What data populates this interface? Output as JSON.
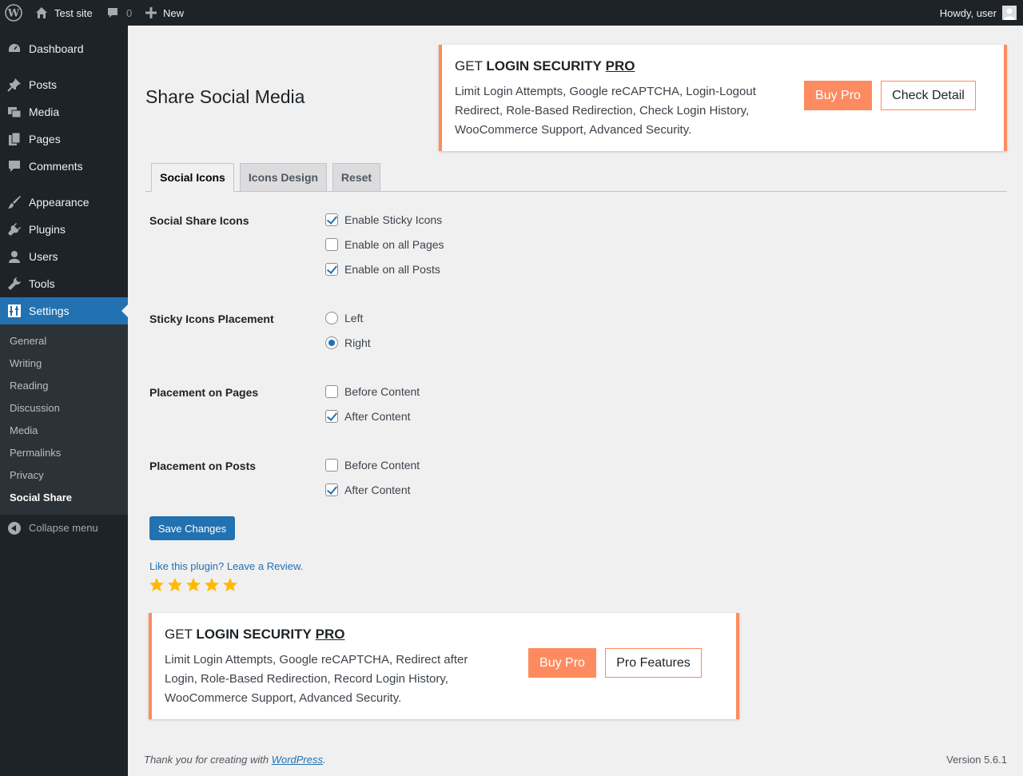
{
  "adminbar": {
    "site_name": "Test site",
    "comments_count": "0",
    "new_label": "New",
    "howdy": "Howdy, user"
  },
  "sidebar": {
    "items": [
      {
        "label": "Dashboard",
        "icon": "dashboard-icon"
      },
      {
        "label": "Posts",
        "icon": "pin-icon"
      },
      {
        "label": "Media",
        "icon": "media-icon"
      },
      {
        "label": "Pages",
        "icon": "pages-icon"
      },
      {
        "label": "Comments",
        "icon": "comment-icon"
      },
      {
        "label": "Appearance",
        "icon": "brush-icon"
      },
      {
        "label": "Plugins",
        "icon": "plugin-icon"
      },
      {
        "label": "Users",
        "icon": "user-icon"
      },
      {
        "label": "Tools",
        "icon": "wrench-icon"
      },
      {
        "label": "Settings",
        "icon": "settings-icon"
      }
    ],
    "submenu": [
      "General",
      "Writing",
      "Reading",
      "Discussion",
      "Media",
      "Permalinks",
      "Privacy",
      "Social Share"
    ],
    "collapse_label": "Collapse menu"
  },
  "page": {
    "title": "Share Social Media"
  },
  "promo_top": {
    "title_prefix": "GET",
    "title_bold": "LOGIN SECURITY",
    "title_pro": "PRO",
    "description": "Limit Login Attempts, Google reCAPTCHA, Login-Logout Redirect, Role-Based Redirection, Check Login History, WooCommerce Support, Advanced Security.",
    "buy_label": "Buy Pro",
    "detail_label": "Check Detail"
  },
  "tabs": [
    "Social Icons",
    "Icons Design",
    "Reset"
  ],
  "form": {
    "social_share_icons": {
      "label": "Social Share Icons",
      "options": [
        {
          "label": "Enable Sticky Icons",
          "checked": true
        },
        {
          "label": "Enable on all Pages",
          "checked": false
        },
        {
          "label": "Enable on all Posts",
          "checked": true
        }
      ]
    },
    "sticky_placement": {
      "label": "Sticky Icons Placement",
      "options": [
        {
          "label": "Left",
          "checked": false
        },
        {
          "label": "Right",
          "checked": true
        }
      ]
    },
    "placement_pages": {
      "label": "Placement on Pages",
      "options": [
        {
          "label": "Before Content",
          "checked": false
        },
        {
          "label": "After Content",
          "checked": true
        }
      ]
    },
    "placement_posts": {
      "label": "Placement on Posts",
      "options": [
        {
          "label": "Before Content",
          "checked": false
        },
        {
          "label": "After Content",
          "checked": true
        }
      ]
    },
    "save_label": "Save Changes"
  },
  "review": {
    "link_text": "Like this plugin? Leave a Review.",
    "stars": 5,
    "star_color": "#ffb900"
  },
  "promo_bottom": {
    "title_prefix": "GET",
    "title_bold": "LOGIN SECURITY",
    "title_pro": "PRO",
    "description": "Limit Login Attempts, Google reCAPTCHA, Redirect after Login, Role-Based Redirection, Record Login History, WooCommerce Support, Advanced Security.",
    "buy_label": "Buy Pro",
    "features_label": "Pro Features"
  },
  "footer": {
    "thanks_prefix": "Thank you for creating with ",
    "wordpress_link": "WordPress",
    "thanks_suffix": ".",
    "version": "Version 5.6.1"
  },
  "colors": {
    "accent": "#2271b1",
    "promo": "#fe8b5f",
    "sidebar_bg": "#1d2327"
  }
}
